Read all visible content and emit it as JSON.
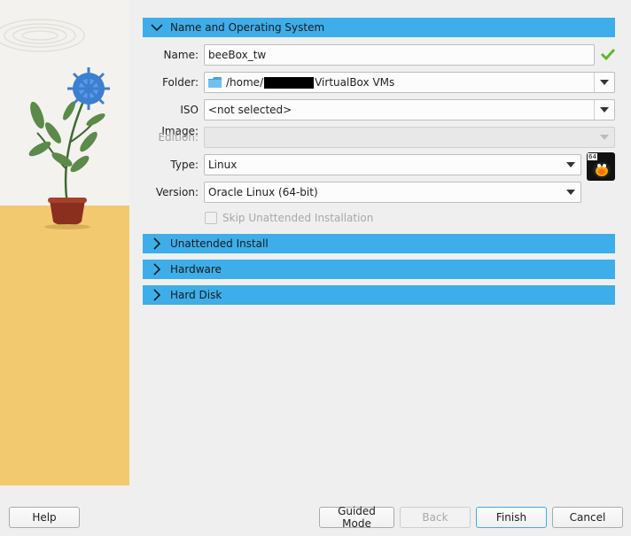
{
  "sections": {
    "name_os": {
      "title": "Name and Operating System",
      "expanded": true
    },
    "unattended": {
      "title": "Unattended Install",
      "expanded": false
    },
    "hardware": {
      "title": "Hardware",
      "expanded": false
    },
    "hard_disk": {
      "title": "Hard Disk",
      "expanded": false
    }
  },
  "form": {
    "name": {
      "label": "Name:",
      "value": "beeBox_tw",
      "valid": true
    },
    "folder": {
      "label": "Folder:",
      "value_prefix": "/home/",
      "value_suffix": "VirtualBox VMs"
    },
    "iso": {
      "label": "ISO Image:",
      "value": "<not selected>"
    },
    "edition": {
      "label": "Edition:",
      "value": ""
    },
    "type": {
      "label": "Type:",
      "value": "Linux"
    },
    "version": {
      "label": "Version:",
      "value": "Oracle Linux (64-bit)"
    },
    "skip_unattended": {
      "label": "Skip Unattended Installation",
      "checked": false,
      "enabled": false
    },
    "os_badge": "64"
  },
  "footer": {
    "help": "Help",
    "guided_mode": "Guided Mode",
    "back": "Back",
    "finish": "Finish",
    "cancel": "Cancel"
  },
  "colors": {
    "section_header": "#3daee9",
    "valid_check": "#5cb82c"
  }
}
